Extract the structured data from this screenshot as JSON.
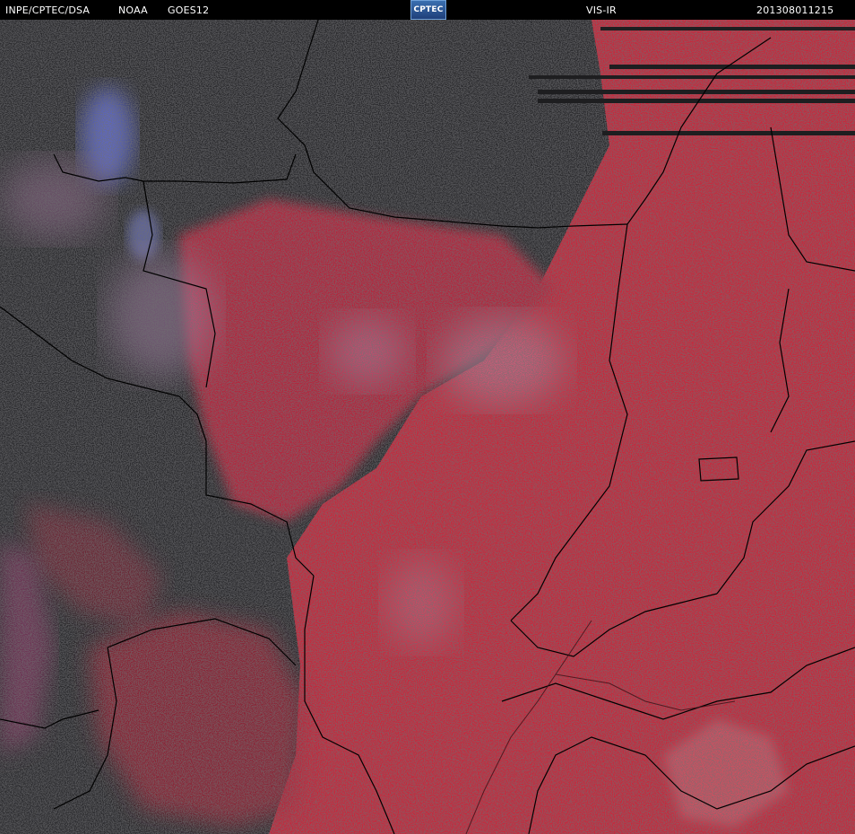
{
  "header": {
    "agency": "INPE/CPTEC/DSA",
    "source": "NOAA",
    "satellite": "GOES12",
    "logo_text": "CPTEC",
    "product": "VIS-IR",
    "timestamp": "201308011215"
  },
  "colors": {
    "background": "#000000",
    "land_dark": "#2d2d30",
    "red_field": "#c8283c",
    "red_light": "#d63a4a",
    "cloud_pinkish": "#b07aa8",
    "cloud_blue": "#6e7cf0",
    "border_line": "#000000"
  }
}
